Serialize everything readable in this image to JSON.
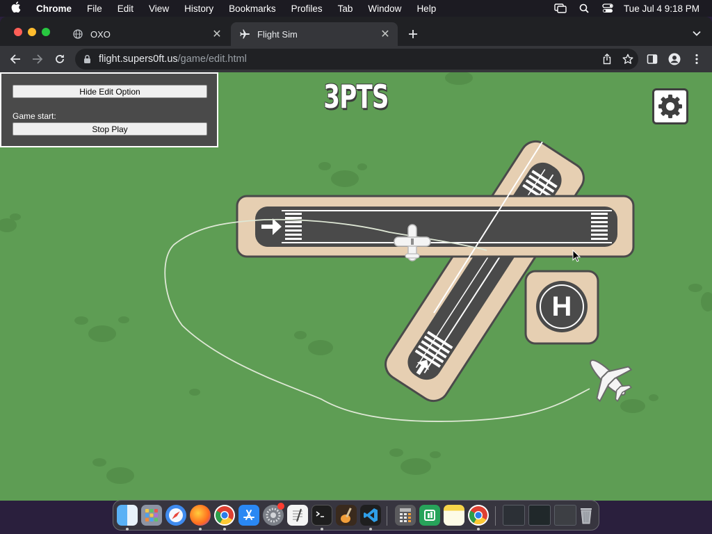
{
  "menubar": {
    "app_name": "Chrome",
    "items": [
      "File",
      "Edit",
      "View",
      "History",
      "Bookmarks",
      "Profiles",
      "Tab",
      "Window",
      "Help"
    ],
    "clock": "Tue Jul 4  9:18 PM"
  },
  "browser": {
    "tabs": [
      {
        "title": "OXO",
        "icon": "globe-icon",
        "active": false
      },
      {
        "title": "Flight Sim",
        "icon": "airplane-icon",
        "active": true
      }
    ],
    "url_host": "flight.supers0ft.us",
    "url_path": "/game/edit.html"
  },
  "game": {
    "score": "3PTS",
    "edit_panel": {
      "hide_button": "Hide Edit Option",
      "game_start_label": "Game start:",
      "stop_button": "Stop Play"
    },
    "helipad_letter": "H",
    "colors": {
      "grass": "#5e9d54",
      "runway": "#4a4a4a",
      "runway_border": "#e6cfb2",
      "trail": "#dfe8d6"
    }
  },
  "dock": {
    "apps": [
      "finder-icon",
      "launchpad-icon",
      "safari-icon",
      "firefox-icon",
      "chrome-icon",
      "app-store-icon",
      "system-settings-icon",
      "textedit-icon",
      "terminal-icon",
      "garageband-icon",
      "vscode-icon",
      "calculator-icon",
      "numbers-icon",
      "notes-icon",
      "chrome-icon",
      "window-1-icon",
      "window-2-icon",
      "window-3-icon",
      "trash-icon"
    ]
  }
}
